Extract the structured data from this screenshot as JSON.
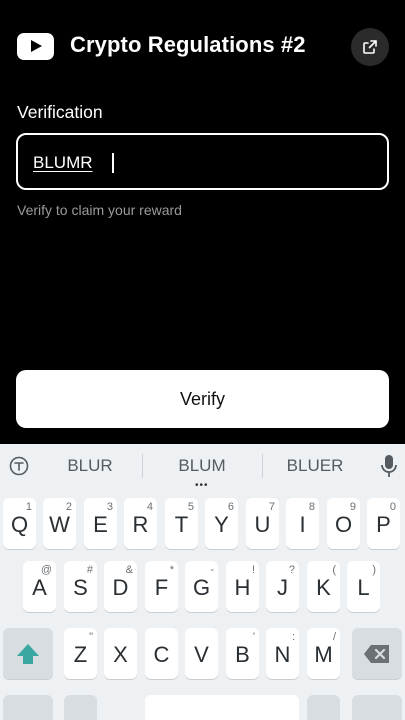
{
  "header": {
    "title": "Crypto Regulations #2",
    "youtube_icon": "youtube-icon",
    "external_link_icon": "external-link-icon"
  },
  "form": {
    "label": "Verification",
    "input_value": "BLUMR",
    "hint": "Verify to claim your reward",
    "verify_label": "Verify"
  },
  "keyboard": {
    "suggestions": [
      "BLUR",
      "BLUM",
      "BLUER"
    ],
    "row1": [
      {
        "ch": "Q",
        "sub": "1"
      },
      {
        "ch": "W",
        "sub": "2"
      },
      {
        "ch": "E",
        "sub": "3"
      },
      {
        "ch": "R",
        "sub": "4"
      },
      {
        "ch": "T",
        "sub": "5"
      },
      {
        "ch": "Y",
        "sub": "6"
      },
      {
        "ch": "U",
        "sub": "7"
      },
      {
        "ch": "I",
        "sub": "8"
      },
      {
        "ch": "O",
        "sub": "9"
      },
      {
        "ch": "P",
        "sub": "0"
      }
    ],
    "row2": [
      {
        "ch": "A",
        "sub": "@"
      },
      {
        "ch": "S",
        "sub": "#"
      },
      {
        "ch": "D",
        "sub": "&"
      },
      {
        "ch": "F",
        "sub": "*"
      },
      {
        "ch": "G",
        "sub": "-"
      },
      {
        "ch": "H",
        "sub": "!"
      },
      {
        "ch": "J",
        "sub": "?"
      },
      {
        "ch": "K",
        "sub": "("
      },
      {
        "ch": "L",
        "sub": ")"
      }
    ],
    "row3": [
      {
        "ch": "Z",
        "sub": "\""
      },
      {
        "ch": "X",
        "sub": ""
      },
      {
        "ch": "C",
        "sub": ""
      },
      {
        "ch": "V",
        "sub": ""
      },
      {
        "ch": "B",
        "sub": "'"
      },
      {
        "ch": "N",
        "sub": ":"
      },
      {
        "ch": "M",
        "sub": "/"
      }
    ],
    "accent_color": "#3aa7a0"
  }
}
